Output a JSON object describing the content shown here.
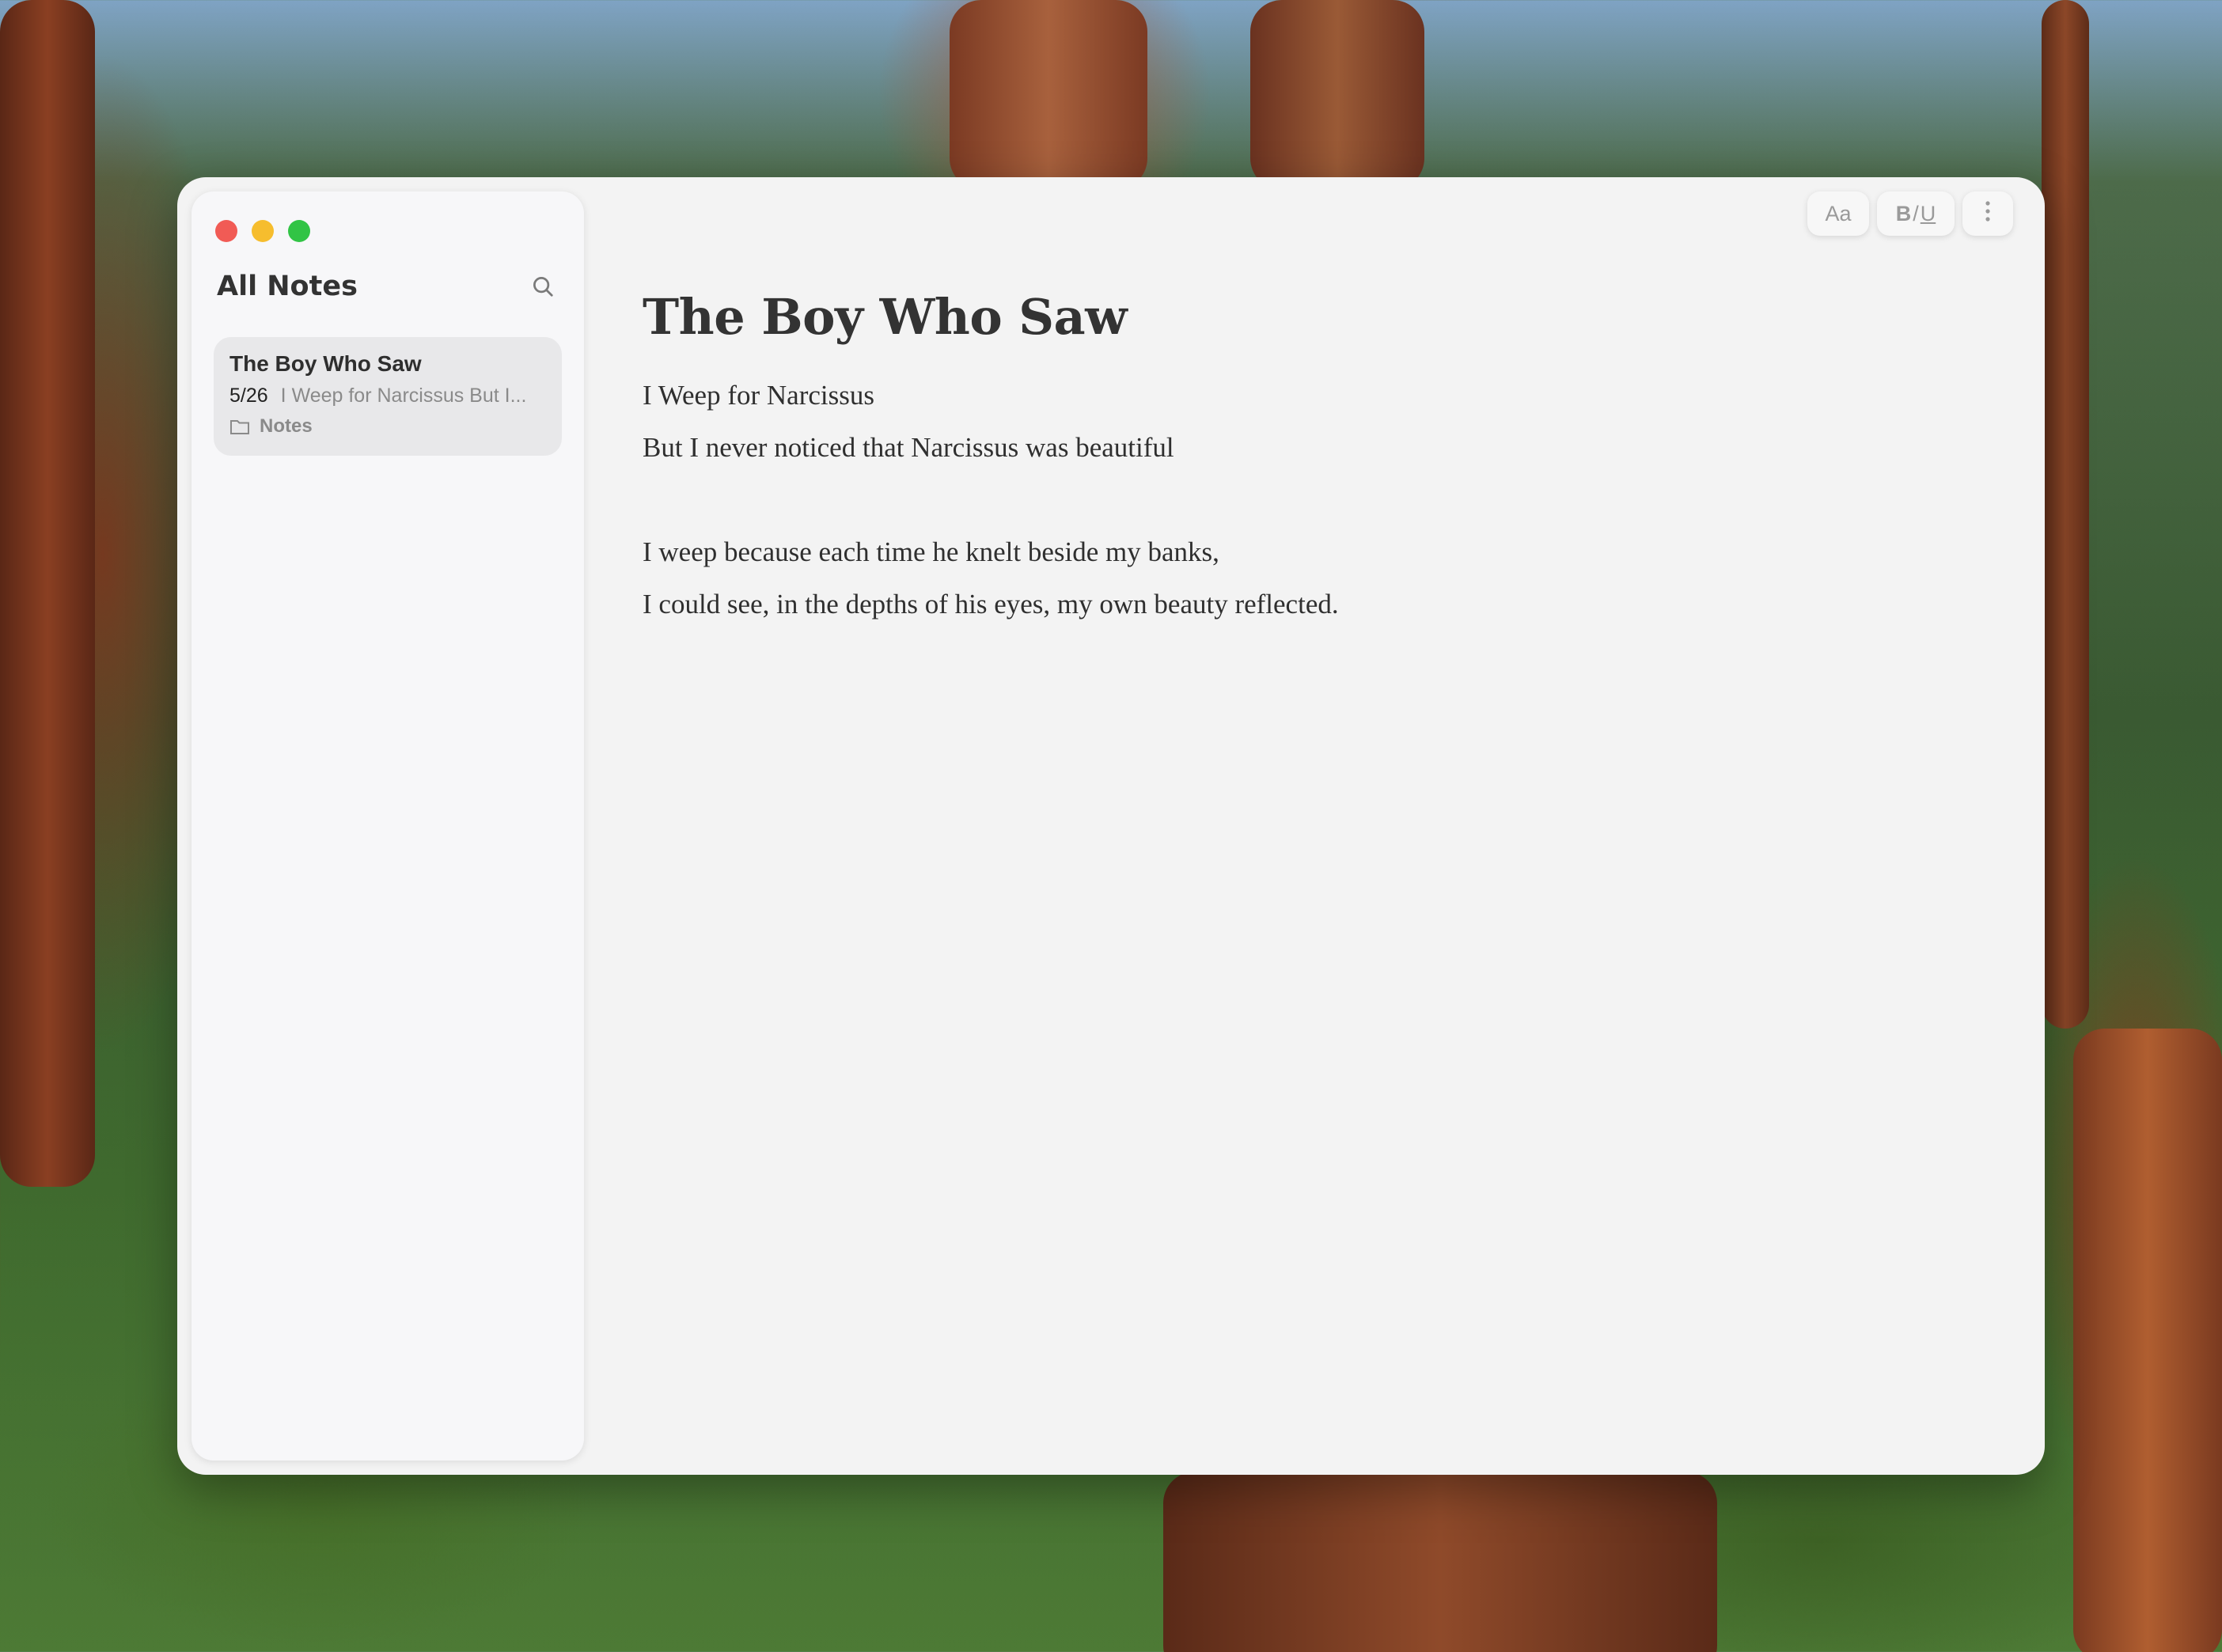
{
  "window": {
    "traffic_lights": [
      "close",
      "minimize",
      "zoom"
    ]
  },
  "sidebar": {
    "title": "All Notes",
    "search_icon": "search-icon",
    "notes": [
      {
        "title": "The Boy Who Saw",
        "date": "5/26",
        "preview": "I Weep for Narcissus But I...",
        "folder": "Notes"
      }
    ]
  },
  "toolbar": {
    "font_label": "Aa",
    "bold_label": "B",
    "slash_label": "/",
    "underline_label": "U",
    "more_icon": "more-vertical-icon"
  },
  "document": {
    "title": "The Boy Who Saw",
    "lines": [
      "I Weep for Narcissus",
      "But I never noticed that Narcissus was beautiful",
      "",
      "I weep because each time he knelt beside my banks,",
      "I could see, in the depths of his eyes, my own beauty reflected."
    ]
  },
  "colors": {
    "close": "#f15b55",
    "minimize": "#f6bd2e",
    "zoom": "#31c445",
    "selected_note_bg": "#e8e8ea"
  }
}
